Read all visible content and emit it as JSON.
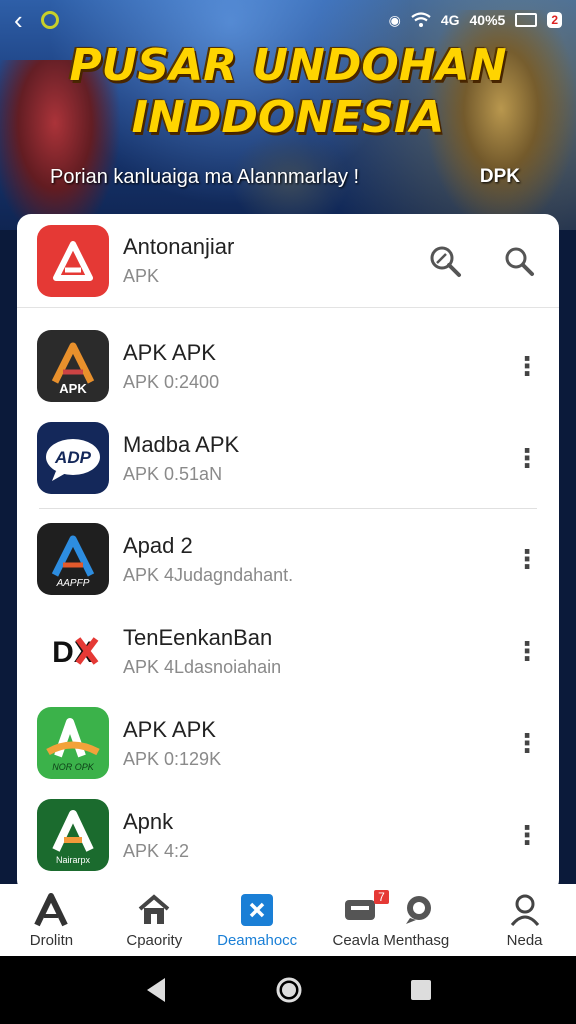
{
  "status_bar": {
    "network": "4G",
    "battery_text": "40%5",
    "notification_badge": "2"
  },
  "hero": {
    "title_line1": "PUSAR UNDOHAN",
    "title_line2": "INDDONESIA",
    "subtitle": "Porian kanluaiga ma Alannmarlay !",
    "tag": "DPK"
  },
  "featured_app": {
    "name": "Antonanjiar",
    "sub": "APK"
  },
  "header_icons": [
    "zoom-search-icon",
    "search-icon"
  ],
  "apps": [
    {
      "name": "APK APK",
      "sub": "APK 0:2400",
      "icon_text": "APK",
      "icon_bg": "#2b2b2b"
    },
    {
      "name": "Madba APK",
      "sub": "APK 0.51aN",
      "icon_text": "ADP",
      "icon_bg": "#14285a"
    },
    {
      "name": "Apad 2",
      "sub": "APK 4Judagndahant.",
      "icon_text": "AAPFP",
      "icon_bg": "#1f1f1f"
    },
    {
      "name": "TenEenkanBan",
      "sub": "APK 4Ldasnoiahain",
      "icon_text": "DX",
      "icon_bg": "#ffffff"
    },
    {
      "name": "APK  APK",
      "sub": "APK 0:129K",
      "icon_text": "NOR OPK",
      "icon_bg": "#3bb24a"
    },
    {
      "name": "Apnk",
      "sub": "APK 4:2",
      "icon_text": "Nairarpx",
      "icon_bg": "#1b6b2e"
    }
  ],
  "bottom_nav": [
    {
      "label": "Drolitn",
      "icon": "a-logo-icon",
      "active": false
    },
    {
      "label": "Cpaority",
      "icon": "home-icon",
      "active": false
    },
    {
      "label": "Deamahocc",
      "icon": "close-box-icon",
      "active": true
    },
    {
      "label": "Ceavla Menthasg",
      "icon": "chat-icon",
      "active": false,
      "badge": "7"
    },
    {
      "label": "Neda",
      "icon": "person-icon",
      "active": false
    }
  ],
  "colors": {
    "accent": "#1a7fd6",
    "featured_red": "#e53935",
    "title_yellow": "#ffd400"
  }
}
